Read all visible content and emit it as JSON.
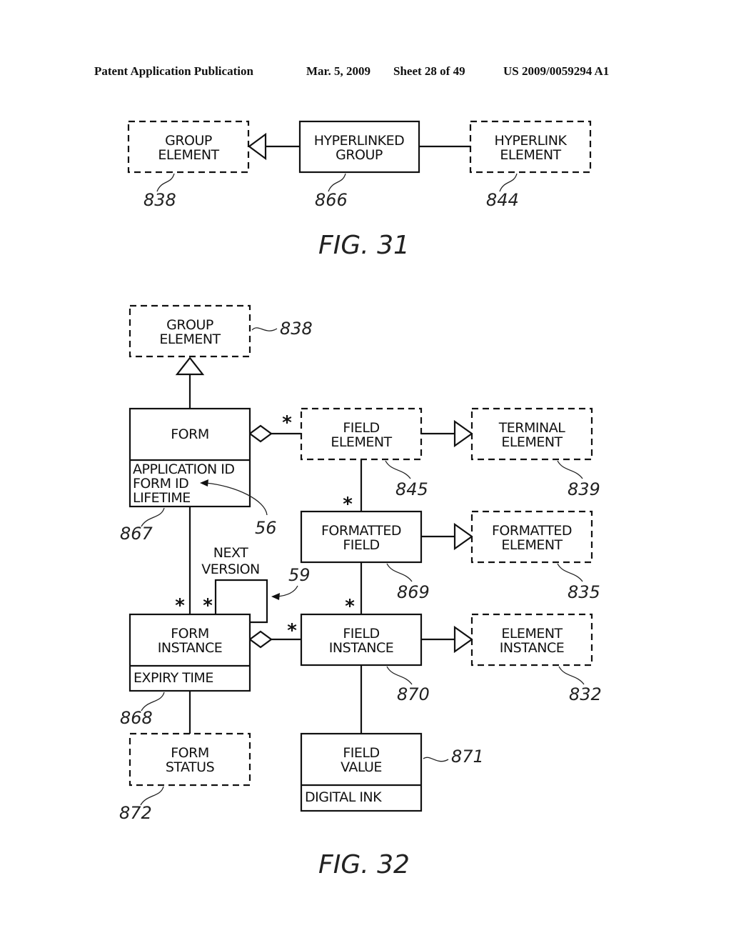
{
  "header": {
    "publication": "Patent Application Publication",
    "date": "Mar. 5, 2009",
    "sheet": "Sheet 28 of 49",
    "patent_number": "US 2009/0059294 A1"
  },
  "fig31": {
    "caption": "FIG. 31",
    "boxes": {
      "group_element": {
        "line1": "GROUP",
        "line2": "ELEMENT",
        "ref": "838",
        "style": "dashed"
      },
      "hyperlinked_group": {
        "line1": "HYPERLINKED",
        "line2": "GROUP",
        "ref": "866",
        "style": "solid"
      },
      "hyperlink_element": {
        "line1": "HYPERLINK",
        "line2": "ELEMENT",
        "ref": "844",
        "style": "dashed"
      }
    }
  },
  "fig32": {
    "caption": "FIG. 32",
    "boxes": {
      "group_element": {
        "line1": "GROUP",
        "line2": "ELEMENT",
        "ref": "838"
      },
      "form": {
        "line1": "FORM",
        "attributes": [
          "APPLICATION ID",
          "FORM ID",
          "LIFETIME"
        ],
        "ref": "867"
      },
      "field_element": {
        "line1": "FIELD",
        "line2": "ELEMENT",
        "ref": "845"
      },
      "terminal_element": {
        "line1": "TERMINAL",
        "line2": "ELEMENT",
        "ref": "839"
      },
      "formatted_field": {
        "line1": "FORMATTED",
        "line2": "FIELD",
        "ref": "869"
      },
      "formatted_element": {
        "line1": "FORMATTED",
        "line2": "ELEMENT",
        "ref": "835"
      },
      "form_instance": {
        "line1": "FORM",
        "line2": "INSTANCE",
        "attributes": [
          "EXPIRY TIME"
        ],
        "ref": "868"
      },
      "field_instance": {
        "line1": "FIELD",
        "line2": "INSTANCE",
        "ref": "870"
      },
      "element_instance": {
        "line1": "ELEMENT",
        "line2": "INSTANCE",
        "ref": "832"
      },
      "form_status": {
        "line1": "FORM",
        "line2": "STATUS",
        "ref": "872"
      },
      "field_value": {
        "line1": "FIELD",
        "line2": "VALUE",
        "attributes": [
          "DIGITAL INK"
        ],
        "ref": "871"
      }
    },
    "annotations": {
      "form_id_ref": "56",
      "next_version_ref": "59",
      "next_version_label_1": "NEXT",
      "next_version_label_2": "VERSION",
      "multiplicity": "*"
    }
  }
}
